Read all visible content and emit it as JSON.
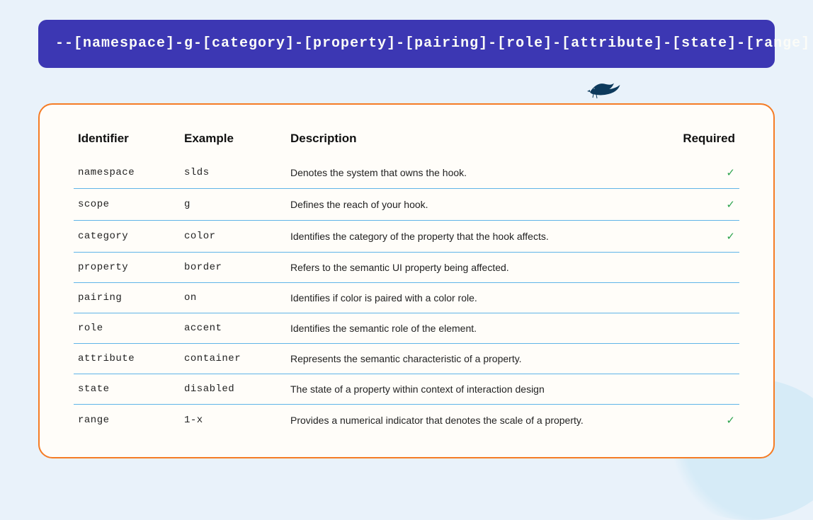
{
  "syntax": "--[namespace]-g-[category]-[property]-[pairing]-[role]-[attribute]-[state]-[range]",
  "columns": {
    "identifier": "Identifier",
    "example": "Example",
    "description": "Description",
    "required": "Required"
  },
  "rows": [
    {
      "identifier": "namespace",
      "example": "slds",
      "description": "Denotes the system that owns the hook.",
      "required": true
    },
    {
      "identifier": "scope",
      "example": "g",
      "description": "Defines the reach of your hook.",
      "required": true
    },
    {
      "identifier": "category",
      "example": "color",
      "description": "Identifies the category of the property that the hook affects.",
      "required": true
    },
    {
      "identifier": "property",
      "example": "border",
      "description": "Refers to the semantic UI property being affected.",
      "required": false
    },
    {
      "identifier": "pairing",
      "example": "on",
      "description": "Identifies if color is paired with a color role.",
      "required": false
    },
    {
      "identifier": "role",
      "example": "accent",
      "description": "Identifies the semantic role of the element.",
      "required": false
    },
    {
      "identifier": "attribute",
      "example": "container",
      "description": "Represents the semantic characteristic of a property.",
      "required": false
    },
    {
      "identifier": "state",
      "example": "disabled",
      "description": "The state of a property within context of interaction design",
      "required": false
    },
    {
      "identifier": "range",
      "example": "1-x",
      "description": "Provides a numerical indicator that denotes the scale of a property.",
      "required": true
    }
  ],
  "checkmark": "✓"
}
